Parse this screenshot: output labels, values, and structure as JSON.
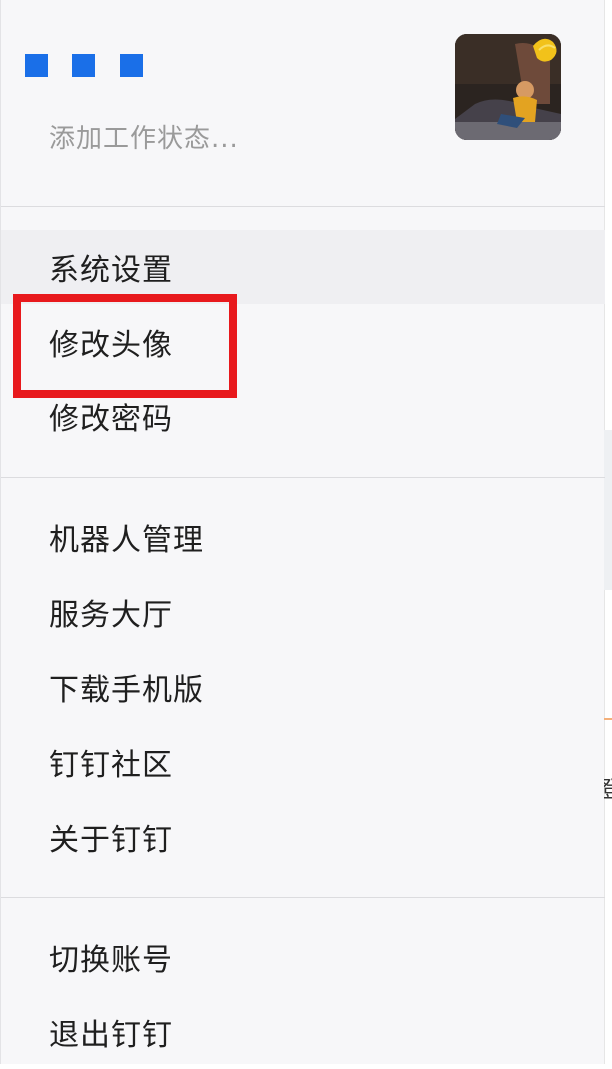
{
  "profile": {
    "status_placeholder": "添加工作状态..."
  },
  "menu": {
    "group1": [
      {
        "label": "系统设置"
      },
      {
        "label": "修改头像"
      },
      {
        "label": "修改密码"
      }
    ],
    "group2": [
      {
        "label": "机器人管理"
      },
      {
        "label": "服务大厅"
      },
      {
        "label": "下载手机版"
      },
      {
        "label": "钉钉社区"
      },
      {
        "label": "关于钉钉"
      }
    ],
    "group3": [
      {
        "label": "切换账号"
      },
      {
        "label": "退出钉钉"
      }
    ]
  },
  "background": {
    "partial_glyph": "登"
  },
  "colors": {
    "name_redaction": "#1a6fe8",
    "highlight": "#e8191d",
    "hover_row": "#efeff2"
  }
}
